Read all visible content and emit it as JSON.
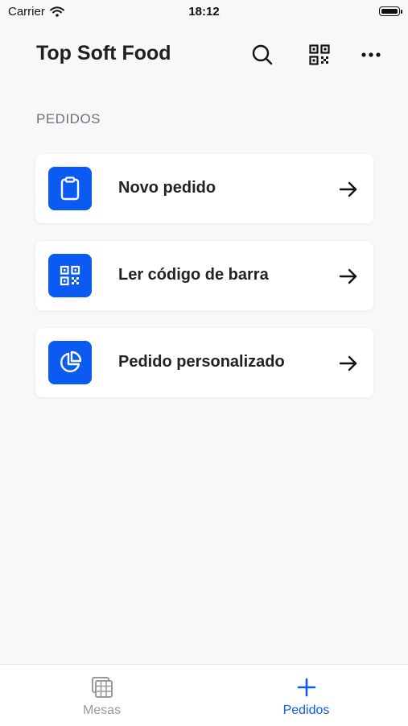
{
  "status_bar": {
    "carrier": "Carrier",
    "time": "18:12"
  },
  "header": {
    "title": "Top Soft Food",
    "icons": [
      "search-icon",
      "qr-code-icon",
      "more-icon"
    ]
  },
  "section": {
    "title": "PEDIDOS"
  },
  "cards": [
    {
      "label": "Novo pedido",
      "icon": "clipboard-icon"
    },
    {
      "label": "Ler código de barra",
      "icon": "qr-code-icon"
    },
    {
      "label": "Pedido personalizado",
      "icon": "pie-chart-icon"
    }
  ],
  "tabbar": {
    "tabs": [
      {
        "label": "Mesas",
        "icon": "table-grid-icon",
        "active": false
      },
      {
        "label": "Pedidos",
        "icon": "plus-icon",
        "active": true
      }
    ]
  },
  "colors": {
    "accent": "#0b5bf2",
    "background": "#f8f8f8",
    "inactive": "#9a9a9a"
  }
}
